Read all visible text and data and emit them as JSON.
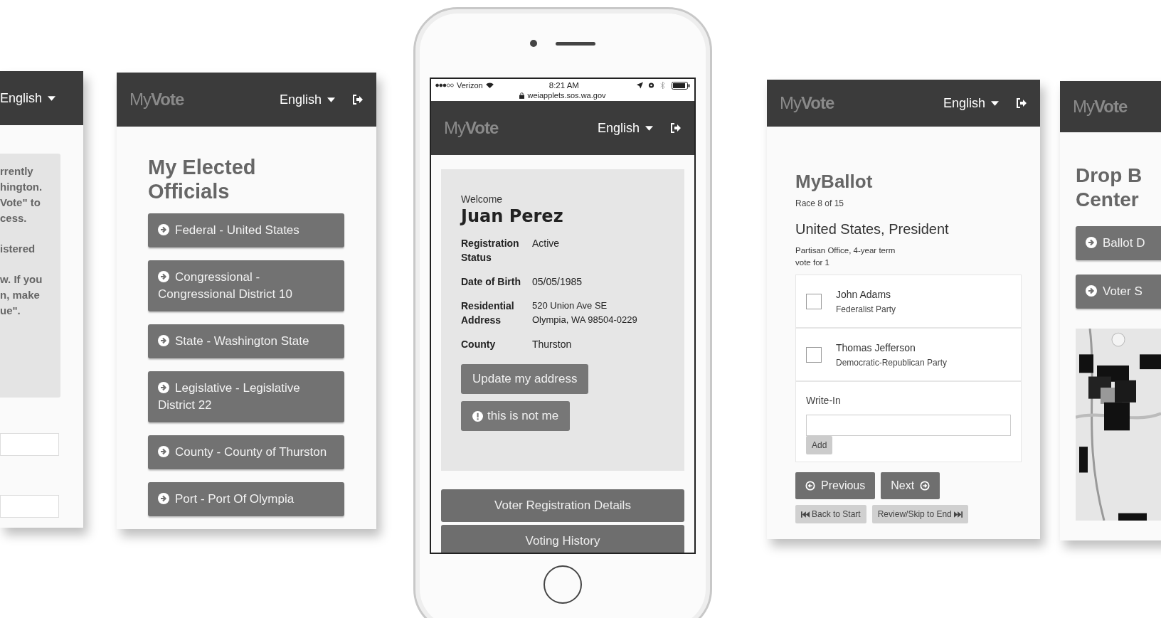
{
  "left_screen": {
    "language": "English",
    "paragraphs": [
      [
        "rrently",
        "hington.",
        "Vote\" to",
        "cess."
      ],
      [
        "istered"
      ],
      [
        "w. If you",
        "n, make",
        "ue\"."
      ]
    ]
  },
  "officials_screen": {
    "logo": "My**Vote**",
    "language": "English",
    "title": "My Elected Officials",
    "items": [
      {
        "label": "Federal - United States"
      },
      {
        "label": "Congressional - Congressional District 10"
      },
      {
        "label": "State - Washington State"
      },
      {
        "label": "Legislative - Legislative District 22"
      },
      {
        "label": "County - County of Thurston"
      },
      {
        "label": "Port - Port Of Olympia"
      }
    ]
  },
  "phone": {
    "status_bar": {
      "carrier": "Verizon",
      "time": "8:21 AM",
      "url": "weiapplets.sos.wa.gov"
    },
    "logo": "My**Vote**",
    "language": "English",
    "welcome": "Welcome",
    "name": "Juan Perez",
    "details": [
      {
        "label": "Registration Status",
        "value": "Active"
      },
      {
        "label": "Date of Birth",
        "value": "05/05/1985"
      },
      {
        "label": "Residential Address",
        "value": "520 Union Ave SE\nOlympia, WA 98504-0229"
      },
      {
        "label": "County",
        "value": "Thurston"
      }
    ],
    "actions": [
      {
        "label": "Update my address",
        "kind": "plain"
      },
      {
        "label": "this is not me",
        "kind": "alert"
      }
    ],
    "sections": [
      "Voter Registration Details",
      "Voting History"
    ]
  },
  "ballot_screen": {
    "logo": "My**Vote**",
    "language": "English",
    "title": "MyBallot",
    "race": "Race 8 of 15",
    "office": "United States, President",
    "office_notes": [
      "Partisan Office, 4-year term",
      "vote for 1"
    ],
    "candidates": [
      {
        "name": "John Adams",
        "party": "Federalist Party",
        "checked": false
      },
      {
        "name": "Thomas Jefferson",
        "party": "Democratic-Republican Party",
        "checked": false
      }
    ],
    "write_in": {
      "label": "Write-In",
      "button": "Add"
    },
    "nav": {
      "previous": "Previous",
      "next": "Next",
      "back": "Back to Start",
      "skip": "Review/Skip to End"
    }
  },
  "dropbox_screen": {
    "logo": "My**Vote**",
    "title_lines": [
      "Drop B",
      "Center"
    ],
    "buttons": [
      "Ballot D",
      "Voter S"
    ],
    "map": {
      "kind": "picture"
    }
  }
}
